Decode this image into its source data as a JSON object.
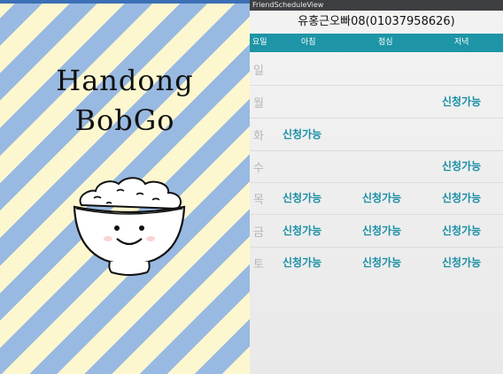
{
  "splash": {
    "title_line1": "Handong",
    "title_line2": "BobGo",
    "colors": {
      "stripe_light": "#fdf7cf",
      "stripe_blue": "#98b9e1",
      "top_bar": "#3b6fb6"
    },
    "illustration": "rice-bowl-smiling-icon"
  },
  "window": {
    "title": "FriendScheduleView"
  },
  "contact": {
    "name_phone": "유홍근오빠08(01037958626)"
  },
  "header": {
    "day": "요일",
    "morning": "아침",
    "lunch": "점심",
    "dinner": "저녁",
    "color": "#1d95a6"
  },
  "schedule": [
    {
      "day": "일",
      "morning": "",
      "lunch": "",
      "dinner": ""
    },
    {
      "day": "월",
      "morning": "",
      "lunch": "",
      "dinner": "신청가능"
    },
    {
      "day": "화",
      "morning": "신청가능",
      "lunch": "",
      "dinner": ""
    },
    {
      "day": "수",
      "morning": "",
      "lunch": "",
      "dinner": "신청가능"
    },
    {
      "day": "목",
      "morning": "신청가능",
      "lunch": "신청가능",
      "dinner": "신청가능"
    },
    {
      "day": "금",
      "morning": "신청가능",
      "lunch": "신청가능",
      "dinner": "신청가능"
    },
    {
      "day": "토",
      "morning": "신청가능",
      "lunch": "신청가능",
      "dinner": "신청가능"
    }
  ],
  "accent_color": "#198fa6"
}
